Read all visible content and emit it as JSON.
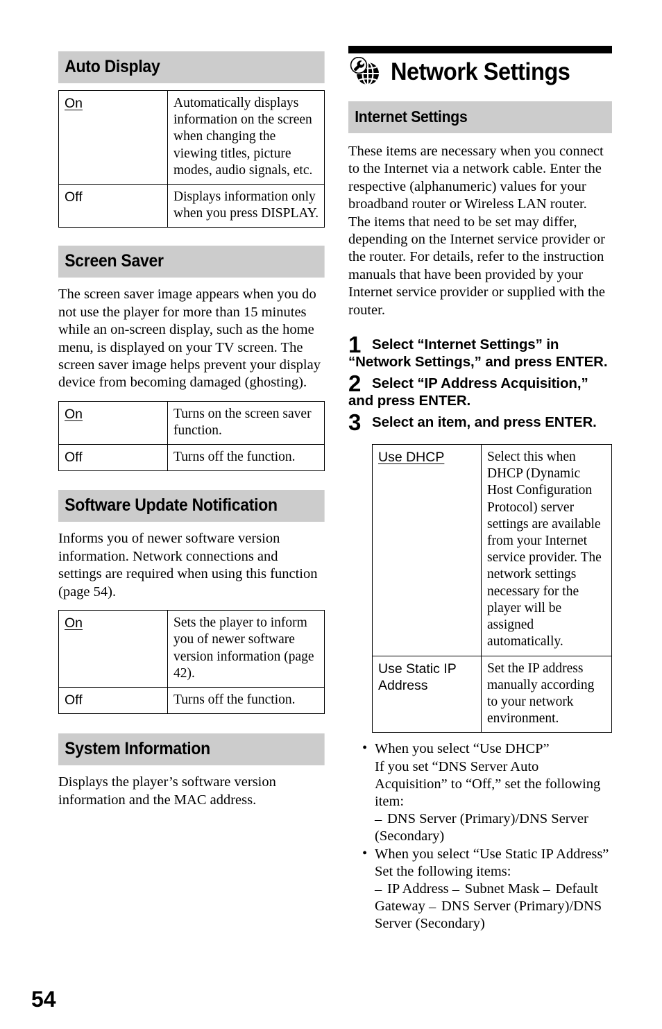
{
  "page": {
    "number": "54",
    "accent_gray": "#cccccc",
    "text_color": "#000000"
  },
  "left_column": {
    "sections": [
      {
        "heading": "Auto Display",
        "table": {
          "rows": [
            {
              "key": "On",
              "key_underlined": true,
              "value": "Automatically displays information on the screen when changing the viewing titles, picture modes, audio signals, etc."
            },
            {
              "key": "Off",
              "key_underlined": false,
              "value": "Displays information only when you press DISPLAY."
            }
          ]
        }
      },
      {
        "heading": "Screen Saver",
        "paragraph": "The screen saver image appears when you do not use the player for more than 15 minutes while an on-screen display, such as the home menu, is displayed on your TV screen. The screen saver image helps prevent your display device from becoming damaged (ghosting).",
        "table": {
          "rows": [
            {
              "key": "On",
              "key_underlined": true,
              "value": "Turns on the screen saver function."
            },
            {
              "key": "Off",
              "key_underlined": false,
              "value": "Turns off the function."
            }
          ]
        }
      },
      {
        "heading": "Software Update Notification",
        "paragraph": "Informs you of newer software version information. Network connections and settings are required when using this function (page 54).",
        "table": {
          "rows": [
            {
              "key": "On",
              "key_underlined": true,
              "value": "Sets the player to inform you of newer software version information (page 42)."
            },
            {
              "key": "Off",
              "key_underlined": false,
              "value": "Turns off the function."
            }
          ]
        }
      },
      {
        "heading": "System Information",
        "paragraph": "Displays the player’s software version information and the MAC address."
      }
    ]
  },
  "right_column": {
    "chapter": {
      "icon": "globe-wrench-icon",
      "title": "Network Settings"
    },
    "section_heading": "Internet Settings",
    "intro": "These items are necessary when you connect to the Internet via a network cable. Enter the respective (alphanumeric) values for your broadband router or Wireless LAN router. The items that need to be set may differ, depending on the Internet service provider or the router. For details, refer to the instruction manuals that have been provided by your Internet service provider or supplied with the router.",
    "steps": [
      {
        "number": "1",
        "text": "Select “Internet Settings” in “Network Settings,” and press ENTER."
      },
      {
        "number": "2",
        "text": "Select “IP Address Acquisition,” and press ENTER."
      },
      {
        "number": "3",
        "text": "Select an item, and press ENTER."
      }
    ],
    "table": {
      "rows": [
        {
          "key": "Use DHCP",
          "key_underlined": true,
          "value": "Select this when DHCP (Dynamic Host Configuration Protocol) server settings are available from your Internet service provider. The network settings necessary for the player will be assigned automatically."
        },
        {
          "key": "Use Static IP Address",
          "key_underlined": false,
          "value": "Set the IP address manually according to your network environment."
        }
      ]
    },
    "notes": [
      {
        "bullet": "•",
        "title": "When you select “Use DHCP”",
        "body": "If you set “DNS Server Auto Acquisition” to “Off,” set the following item:",
        "sub_items": [
          "DNS Server (Primary)/DNS Server (Secondary)"
        ]
      },
      {
        "bullet": "•",
        "title": "When you select “Use Static IP Address”",
        "body": "Set the following items:",
        "sub_items": [
          "IP Address",
          "Subnet Mask",
          "Default Gateway",
          "DNS Server (Primary)/DNS Server (Secondary)"
        ]
      }
    ]
  }
}
